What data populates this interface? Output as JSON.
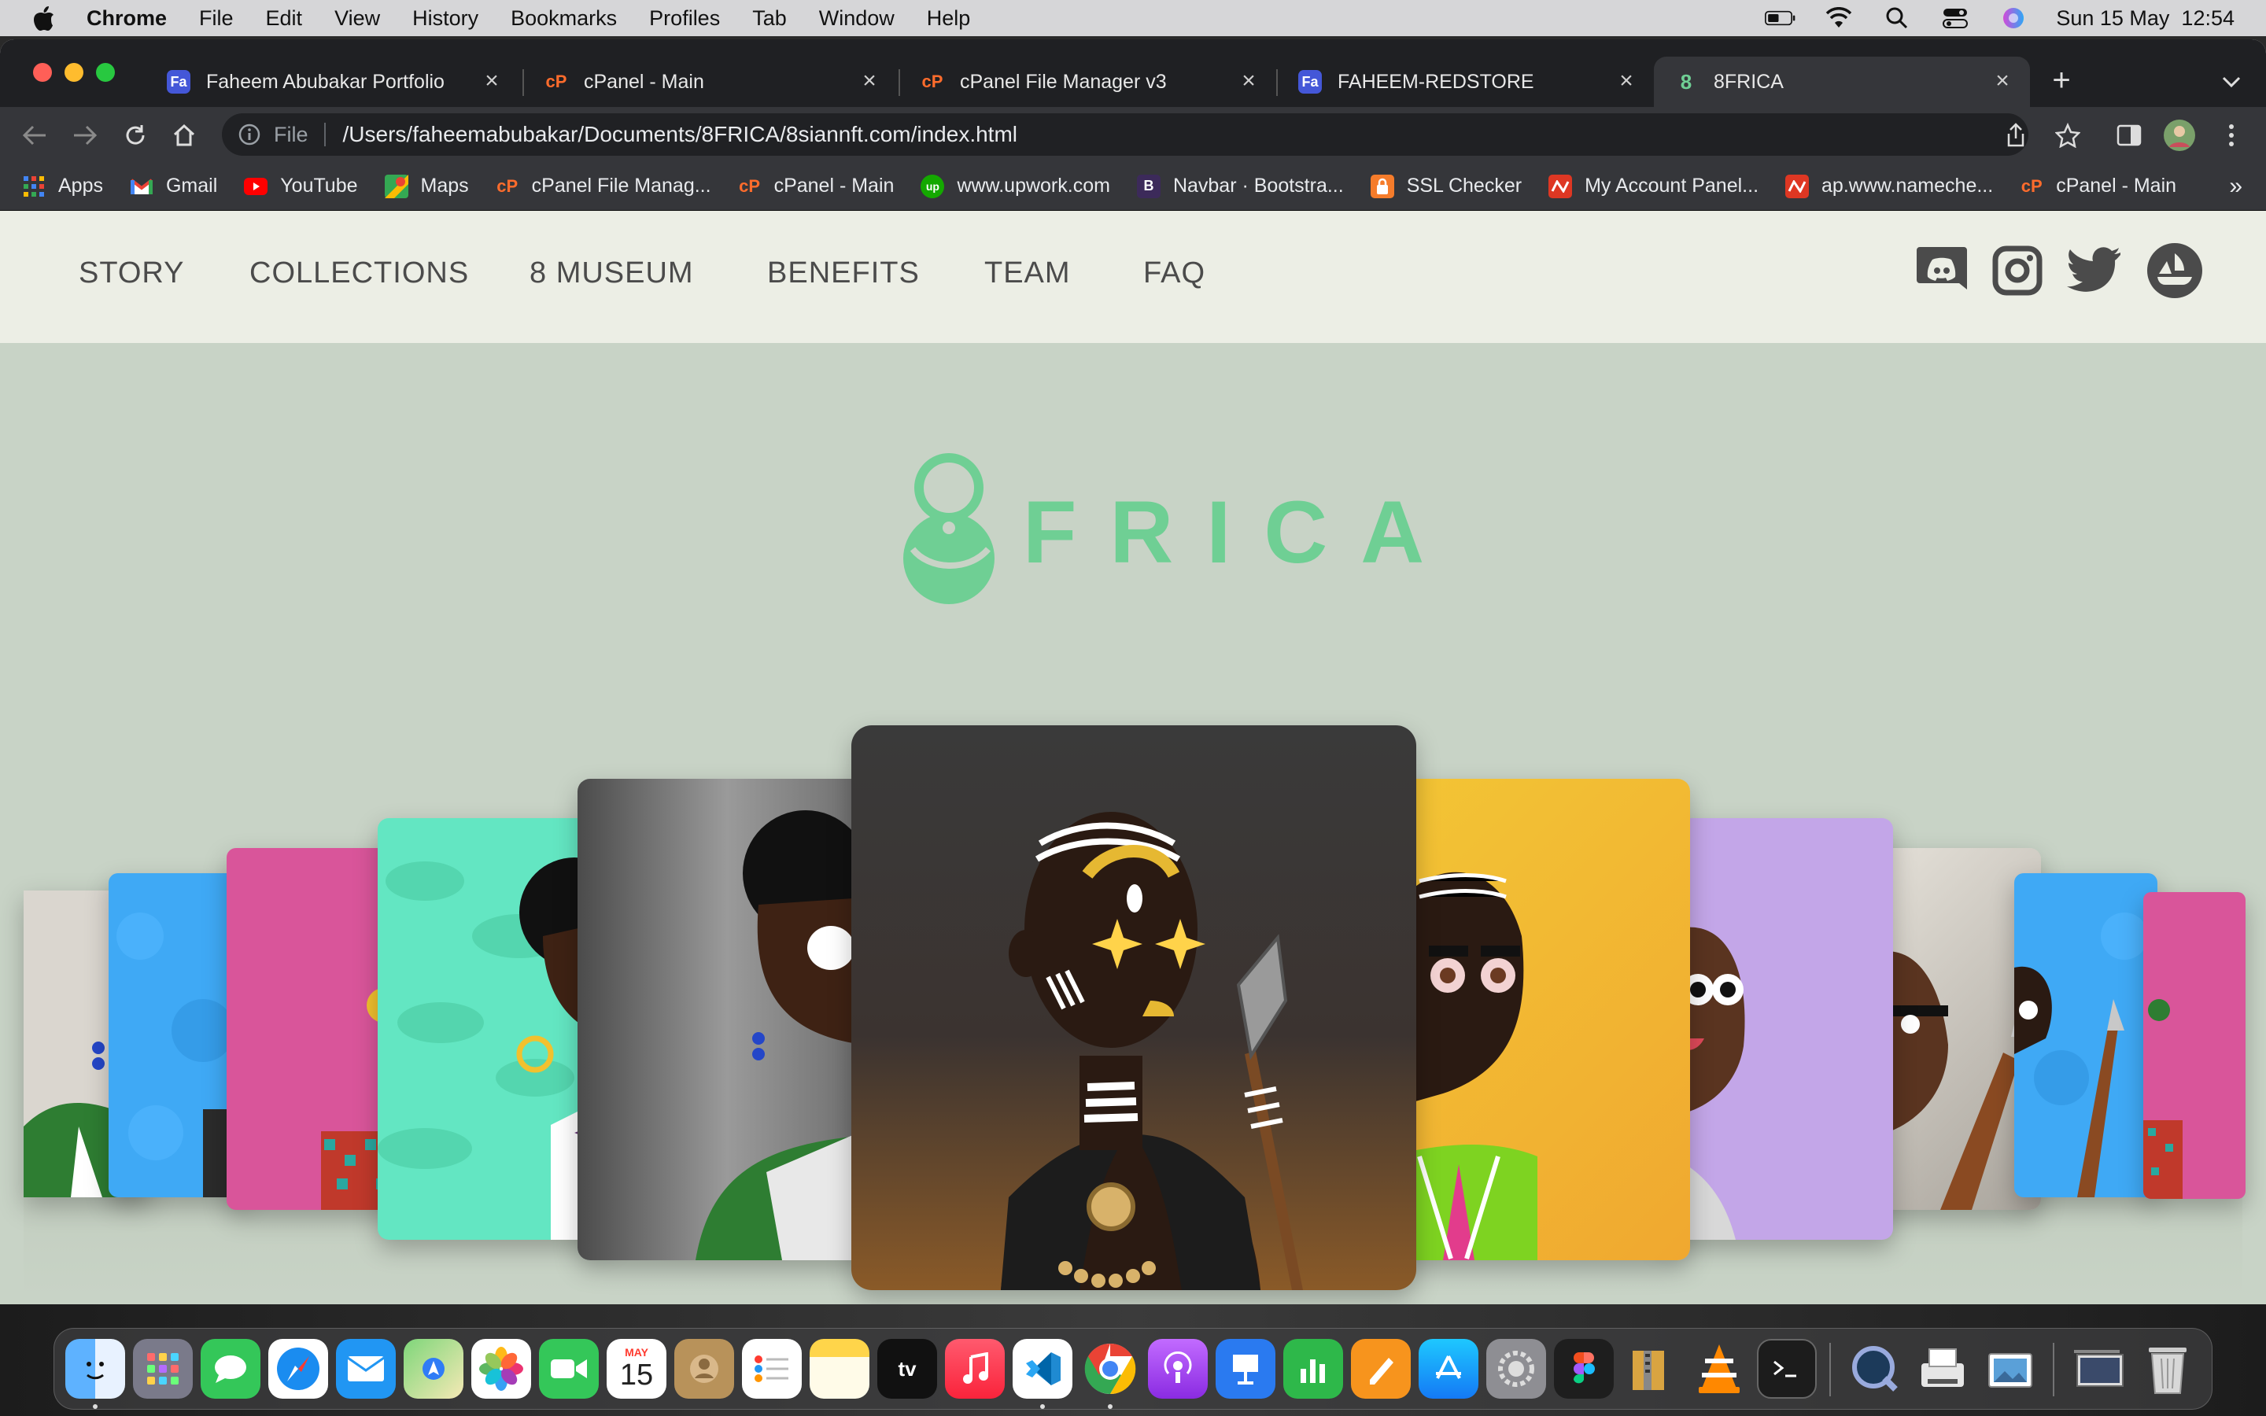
{
  "menubar": {
    "app_name": "Chrome",
    "items": [
      "File",
      "Edit",
      "View",
      "History",
      "Bookmarks",
      "Profiles",
      "Tab",
      "Window",
      "Help"
    ],
    "clock": "Sun 15 May  12:54"
  },
  "tabs": [
    {
      "title": "Faheem Abubakar Portfolio",
      "favicon": "Fa",
      "favicon_color": "#4457d8"
    },
    {
      "title": "cPanel - Main",
      "favicon": "cP",
      "favicon_color": "#ff6c2c"
    },
    {
      "title": "cPanel File Manager v3",
      "favicon": "cP",
      "favicon_color": "#ff6c2c"
    },
    {
      "title": "FAHEEM-REDSTORE",
      "favicon": "Fa",
      "favicon_color": "#4457d8"
    },
    {
      "title": "8FRICA",
      "favicon": "8",
      "favicon_color": "#6fcf94",
      "active": true
    }
  ],
  "omnibox": {
    "scheme": "File",
    "url": "/Users/faheemabubakar/Documents/8FRICA/8siannft.com/index.html"
  },
  "bookmarks": [
    {
      "label": "Apps",
      "icon": "apps-grid-icon",
      "color": "#4285f4"
    },
    {
      "label": "Gmail",
      "icon": "gmail-icon",
      "color": "#ea4335"
    },
    {
      "label": "YouTube",
      "icon": "youtube-icon",
      "color": "#ff0000"
    },
    {
      "label": "Maps",
      "icon": "maps-icon",
      "color": "#34a853"
    },
    {
      "label": "cPanel File Manag...",
      "icon": "cpanel-icon",
      "color": "#ff6c2c"
    },
    {
      "label": "cPanel - Main",
      "icon": "cpanel-icon",
      "color": "#ff6c2c"
    },
    {
      "label": "www.upwork.com",
      "icon": "upwork-icon",
      "color": "#14a800"
    },
    {
      "label": "Navbar · Bootstra...",
      "icon": "bootstrap-icon",
      "color": "#7952b3"
    },
    {
      "label": "SSL Checker",
      "icon": "lock-icon",
      "color": "#f57c2b"
    },
    {
      "label": "My Account Panel...",
      "icon": "namecheap-icon",
      "color": "#de3723"
    },
    {
      "label": "ap.www.nameche...",
      "icon": "namecheap-icon",
      "color": "#de3723"
    },
    {
      "label": "cPanel - Main",
      "icon": "cpanel-icon",
      "color": "#ff6c2c"
    }
  ],
  "site": {
    "nav": [
      "STORY",
      "COLLECTIONS",
      "8 MUSEUM",
      "BENEFITS",
      "TEAM",
      "FAQ"
    ],
    "social": [
      "discord-icon",
      "instagram-icon",
      "twitter-icon",
      "opensea-icon"
    ],
    "logo_text": "FRICA",
    "brand_color": "#6fcf94",
    "nav_bg": "#eceee5",
    "page_bg": "#c8d3c6"
  },
  "carousel": {
    "cards": [
      {
        "name": "card-far-left-1",
        "bg": "#d9d6cf"
      },
      {
        "name": "card-far-left-2",
        "bg": "#3fa9f5"
      },
      {
        "name": "card-left-3",
        "bg": "#d9559a"
      },
      {
        "name": "card-left-2",
        "bg": "#63e6c2"
      },
      {
        "name": "card-left-1",
        "bg": "#5a5a5a"
      },
      {
        "name": "card-center",
        "bg": "#3a3a3a"
      },
      {
        "name": "card-right-1",
        "bg": "#f2c12e"
      },
      {
        "name": "card-right-2",
        "bg": "#c3a6e8"
      },
      {
        "name": "card-right-3",
        "bg": "#dad6ce"
      },
      {
        "name": "card-far-right-2",
        "bg": "#3fa9f5"
      },
      {
        "name": "card-far-right-1",
        "bg": "#d9559a"
      }
    ]
  },
  "dock": {
    "calendar_month": "MAY",
    "calendar_day": "15",
    "apps": [
      "finder-icon",
      "launchpad-icon",
      "messages-icon",
      "safari-icon",
      "mail-icon",
      "maps-icon",
      "photos-icon",
      "facetime-icon",
      "calendar-icon",
      "contacts-icon",
      "reminders-icon",
      "notes-icon",
      "appletv-icon",
      "music-icon",
      "vscode-icon",
      "chrome-icon",
      "podcasts-icon",
      "keynote-icon",
      "numbers-icon",
      "pages-icon",
      "appstore-icon",
      "system-preferences-icon",
      "figma-icon",
      "archive-utility-icon",
      "vlc-icon",
      "terminal-icon",
      "quicktime-icon",
      "preview-icon",
      "image-capture-icon",
      "downloads-stack-icon",
      "trash-icon"
    ]
  }
}
